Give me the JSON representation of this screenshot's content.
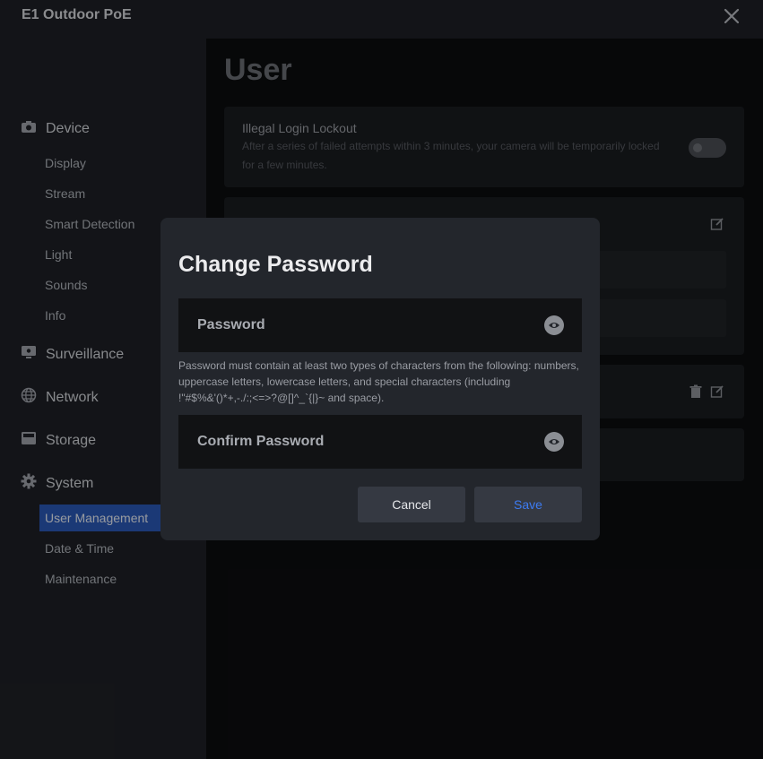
{
  "app": {
    "title": "E1 Outdoor PoE"
  },
  "sidebar": {
    "groups": [
      {
        "label": "Device",
        "icon": "camera-icon"
      },
      {
        "label": "Surveillance",
        "icon": "monitor-icon"
      },
      {
        "label": "Network",
        "icon": "globe-icon"
      },
      {
        "label": "Storage",
        "icon": "storage-icon"
      },
      {
        "label": "System",
        "icon": "gear-icon"
      }
    ],
    "device_items": [
      "Display",
      "Stream",
      "Smart Detection",
      "Light",
      "Sounds",
      "Info"
    ],
    "system_items": [
      "User Management",
      "Date & Time",
      "Maintenance"
    ],
    "active_item": "User Management"
  },
  "main": {
    "title": "User",
    "lockout": {
      "title": "Illegal Login Lockout",
      "description": "After a series of failed attempts within 3 minutes, your camera will be temporarily locked for a few minutes.",
      "enabled": false
    }
  },
  "modal": {
    "title": "Change Password",
    "password_placeholder": "Password",
    "confirm_placeholder": "Confirm Password",
    "hint": "Password must contain at least two types of characters from the following: numbers, uppercase letters, lowercase letters, and special characters (including !\"#$%&'()*+,-./:;<=>?@[]^_`{|}~ and space).",
    "cancel_label": "Cancel",
    "save_label": "Save"
  },
  "colors": {
    "accent": "#2a58b6",
    "save_text": "#3d7bf2",
    "modal_bg": "#23262c"
  }
}
